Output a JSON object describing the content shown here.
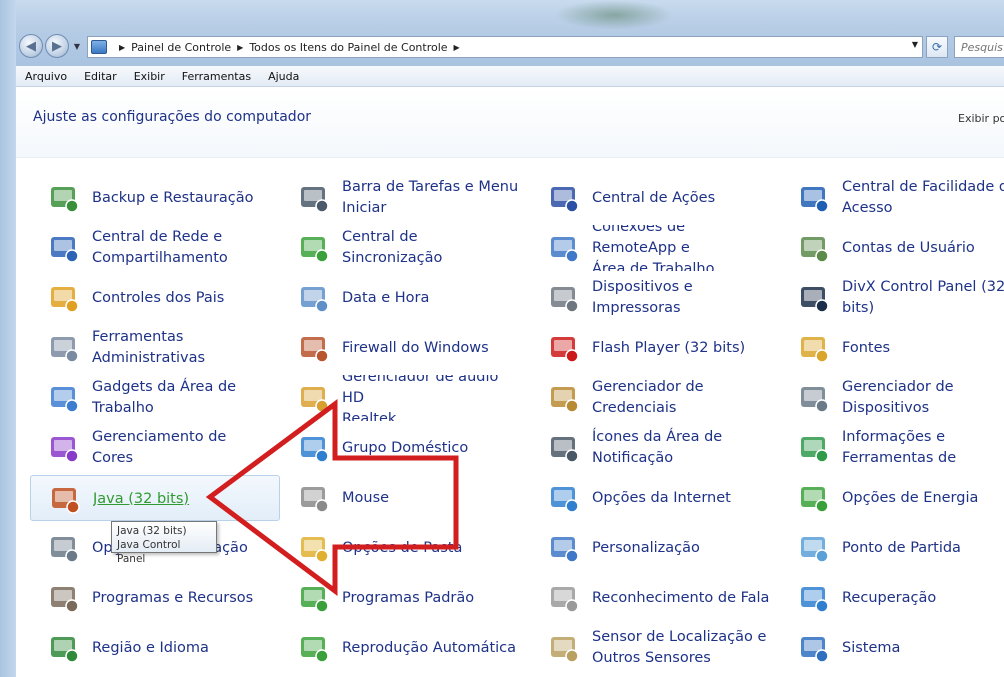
{
  "address": {
    "crumbs": [
      "Painel de Controle",
      "Todos os Itens do Painel de Controle"
    ]
  },
  "search": {
    "placeholder": "Pesquis"
  },
  "menu": [
    "Arquivo",
    "Editar",
    "Exibir",
    "Ferramentas",
    "Ajuda"
  ],
  "page": {
    "title": "Ajuste as configurações do computador",
    "view_by": "Exibir po"
  },
  "tooltip": {
    "line1": "Java (32 bits)",
    "line2": "Java Control Panel"
  },
  "items": [
    {
      "lines": [
        "Backup e Restauração"
      ],
      "icon": "backup-icon",
      "color": "#3a8f3a"
    },
    {
      "lines": [
        "Barra de Tarefas e Menu",
        "Iniciar"
      ],
      "icon": "taskbar-icon",
      "color": "#4a5a6a"
    },
    {
      "lines": [
        "Central de Ações"
      ],
      "icon": "action-center-flag-icon",
      "color": "#2b4fa5"
    },
    {
      "lines": [
        "Central de Facilidade de",
        "Acesso"
      ],
      "icon": "ease-of-access-icon",
      "color": "#1f5fb3"
    },
    {
      "lines": [
        "Central de Rede e",
        "Compartilhamento"
      ],
      "icon": "network-icon",
      "color": "#2c63b7"
    },
    {
      "lines": [
        "Central de Sincronização"
      ],
      "icon": "sync-icon",
      "color": "#3aa13a"
    },
    {
      "lines": [
        "Conexões de RemoteApp e",
        "Área de Trabalho"
      ],
      "icon": "remoteapp-icon",
      "color": "#3f78c8"
    },
    {
      "lines": [
        "Contas de Usuário"
      ],
      "icon": "user-accounts-icon",
      "color": "#5b8a4a"
    },
    {
      "lines": [
        "Controles dos Pais"
      ],
      "icon": "parental-controls-icon",
      "color": "#e0a020"
    },
    {
      "lines": [
        "Data e Hora"
      ],
      "icon": "date-time-icon",
      "color": "#5e8fc9"
    },
    {
      "lines": [
        "Dispositivos e Impressoras"
      ],
      "icon": "printer-icon",
      "color": "#6e7780"
    },
    {
      "lines": [
        "DivX Control Panel (32",
        "bits)"
      ],
      "icon": "divx-icon",
      "color": "#1c2f4a"
    },
    {
      "lines": [
        "Ferramentas",
        "Administrativas"
      ],
      "icon": "admin-tools-icon",
      "color": "#7a8aa0"
    },
    {
      "lines": [
        "Firewall do Windows"
      ],
      "icon": "firewall-icon",
      "color": "#b8542e"
    },
    {
      "lines": [
        "Flash Player (32 bits)"
      ],
      "icon": "flash-icon",
      "color": "#cc1a1a"
    },
    {
      "lines": [
        "Fontes"
      ],
      "icon": "fonts-icon",
      "color": "#d9a52a"
    },
    {
      "lines": [
        "Gadgets da Área de",
        "Trabalho"
      ],
      "icon": "gadgets-icon",
      "color": "#3d7dd0"
    },
    {
      "lines": [
        "Gerenciador de áudio HD",
        "Realtek"
      ],
      "icon": "audio-icon",
      "color": "#d8a030"
    },
    {
      "lines": [
        "Gerenciador de",
        "Credenciais"
      ],
      "icon": "credentials-icon",
      "color": "#b88a32"
    },
    {
      "lines": [
        "Gerenciador de",
        "Dispositivos"
      ],
      "icon": "device-manager-icon",
      "color": "#6a7a88"
    },
    {
      "lines": [
        "Gerenciamento de Cores"
      ],
      "icon": "color-management-icon",
      "color": "#8a3ac9"
    },
    {
      "lines": [
        "Grupo Doméstico"
      ],
      "icon": "homegroup-icon",
      "color": "#2f7fd0"
    },
    {
      "lines": [
        "Ícones da Área de",
        "Notificação"
      ],
      "icon": "notification-icons-icon",
      "color": "#4a5866"
    },
    {
      "lines": [
        "Informações e",
        "Ferramentas de"
      ],
      "icon": "performance-icon",
      "color": "#2e9a4a"
    },
    {
      "lines": [
        "Java (32 bits)"
      ],
      "icon": "java-icon",
      "color": "#c0501f",
      "selected": true
    },
    {
      "lines": [
        "Mouse"
      ],
      "icon": "mouse-icon",
      "color": "#8a8a8a"
    },
    {
      "lines": [
        "Opções da Internet"
      ],
      "icon": "internet-options-icon",
      "color": "#2f7fd0"
    },
    {
      "lines": [
        "Opções de Energia"
      ],
      "icon": "power-options-icon",
      "color": "#3aa13a"
    },
    {
      "lines": [
        "Opções de Indexação"
      ],
      "icon": "indexing-icon",
      "color": "#6a7a88"
    },
    {
      "lines": [
        "Opções de Pasta"
      ],
      "icon": "folder-options-icon",
      "color": "#e0b030"
    },
    {
      "lines": [
        "Personalização"
      ],
      "icon": "personalization-icon",
      "color": "#3f78c8"
    },
    {
      "lines": [
        "Ponto de Partida"
      ],
      "icon": "getting-started-icon",
      "color": "#5aa0d8"
    },
    {
      "lines": [
        "Programas e Recursos"
      ],
      "icon": "programs-icon",
      "color": "#7a6a5a"
    },
    {
      "lines": [
        "Programas Padrão"
      ],
      "icon": "default-programs-icon",
      "color": "#3aa13a"
    },
    {
      "lines": [
        "Reconhecimento de Fala"
      ],
      "icon": "speech-icon",
      "color": "#9a9a9a"
    },
    {
      "lines": [
        "Recuperação"
      ],
      "icon": "recovery-icon",
      "color": "#2f7fd0"
    },
    {
      "lines": [
        "Região e Idioma"
      ],
      "icon": "region-icon",
      "color": "#2f8a3a"
    },
    {
      "lines": [
        "Reprodução Automática"
      ],
      "icon": "autoplay-icon",
      "color": "#3aa13a"
    },
    {
      "lines": [
        "Sensor de Localização e",
        "Outros Sensores"
      ],
      "icon": "sensors-icon",
      "color": "#b8a060"
    },
    {
      "lines": [
        "Sistema"
      ],
      "icon": "system-icon",
      "color": "#2f6fc0"
    }
  ],
  "colors": {
    "link": "#1e3287",
    "selected_link": "#2f9a2f",
    "arrow": "#d21e1e"
  }
}
